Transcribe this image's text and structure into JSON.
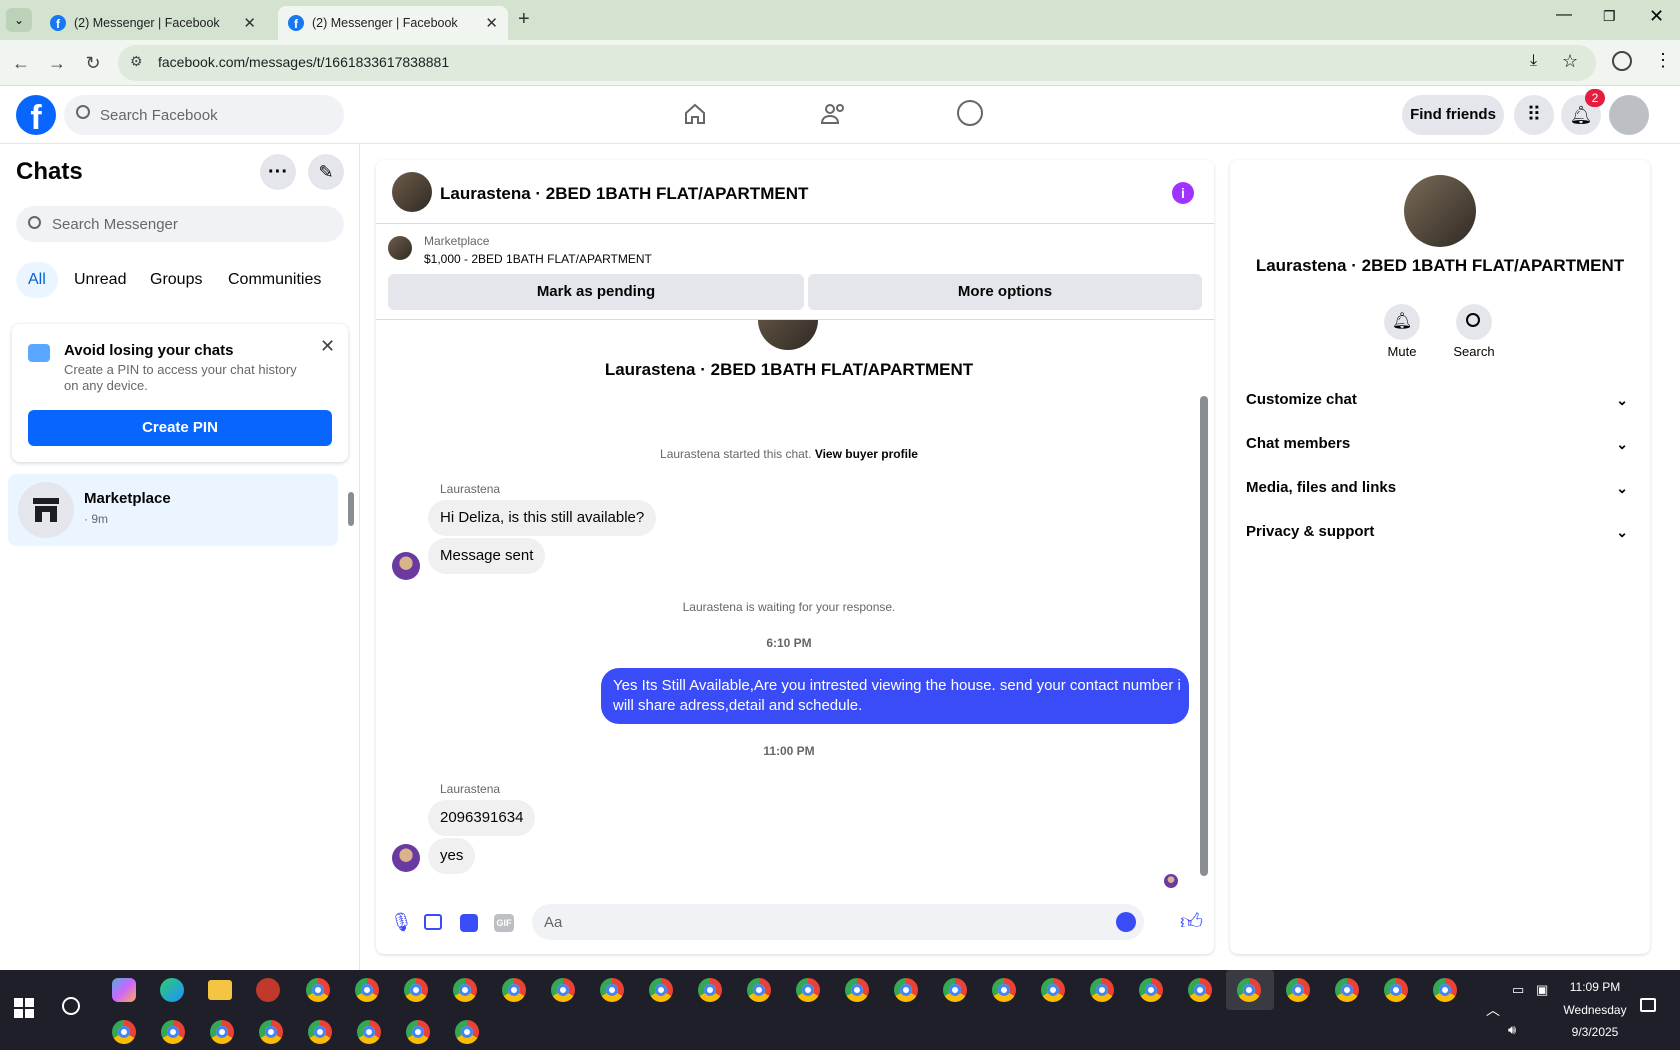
{
  "browser": {
    "tabs": [
      {
        "title": "(2) Messenger | Facebook",
        "active": false
      },
      {
        "title": "(2) Messenger | Facebook",
        "active": true
      }
    ],
    "url": "facebook.com/messages/t/1661833617838881"
  },
  "fb": {
    "search_placeholder": "Search Facebook",
    "find_friends": "Find friends",
    "notif_count": "2"
  },
  "left": {
    "title": "Chats",
    "search_placeholder": "Search Messenger",
    "filters": [
      "All",
      "Unread",
      "Groups",
      "Communities"
    ],
    "pin_card": {
      "title": "Avoid losing your chats",
      "body_line1": "Create a PIN to access your chat history",
      "body_line2": "on any device.",
      "button": "Create PIN"
    },
    "chat_item": {
      "name": "Marketplace",
      "meta": "· 9m"
    }
  },
  "thread": {
    "header_title": "Laurastena · 2BED 1BATH FLAT/APARTMENT",
    "listing_label": "Marketplace",
    "listing_price": "$1,000 - 2BED 1BATH FLAT/APARTMENT",
    "mark_pending": "Mark as pending",
    "more_options": "More options",
    "profile_name": "Laurastena · 2BED 1BATH FLAT/APARTMENT",
    "started_text": "Laurastena started this chat.",
    "view_buyer": "View buyer profile",
    "sender1": "Laurastena",
    "msg1": "Hi Deliza, is this still available?",
    "msg2": "Message sent",
    "waiting": "Laurastena is waiting for your response.",
    "time1": "6:10 PM",
    "out_line1": "Yes Its Still Available,Are you intrested viewing the house. send your contact number i",
    "out_line2": "will share adress,detail and schedule.",
    "time2": "11:00 PM",
    "sender2": "Laurastena",
    "msg3": "2096391634",
    "msg4": "yes",
    "composer_placeholder": "Aa"
  },
  "right": {
    "name": "Laurastena · 2BED 1BATH FLAT/APARTMENT",
    "mute": "Mute",
    "search": "Search",
    "sections": [
      "Customize chat",
      "Chat members",
      "Media, files and links",
      "Privacy & support"
    ]
  },
  "taskbar": {
    "time": "11:09 PM",
    "day": "Wednesday",
    "date": "9/3/2025"
  },
  "colors": {
    "fb_blue": "#0866ff",
    "outgoing": "#3a4cf7",
    "accent_purple": "#a033ff"
  }
}
